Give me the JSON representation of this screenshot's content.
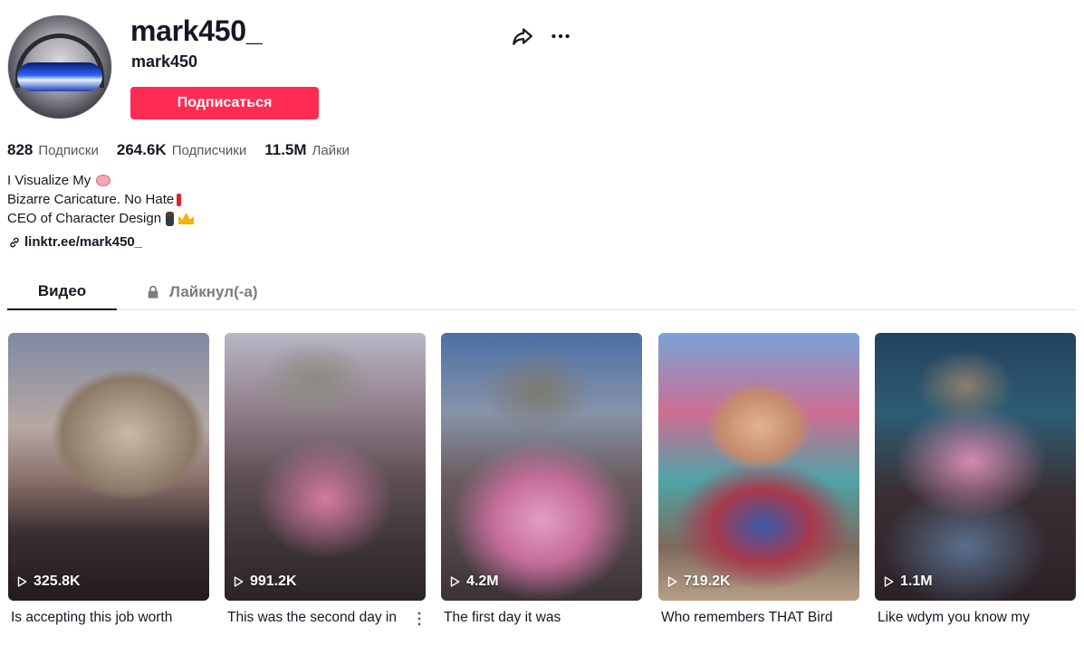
{
  "profile": {
    "username": "mark450_",
    "nickname": "mark450",
    "follow_label": "Подписаться"
  },
  "stats": [
    {
      "value": "828",
      "label": "Подписки"
    },
    {
      "value": "264.6K",
      "label": "Подписчики"
    },
    {
      "value": "11.5M",
      "label": "Лайки"
    }
  ],
  "bio": {
    "line1": "I Visualize My",
    "line2": "Bizarre Caricature. No Hate",
    "line3": "CEO of Character Design",
    "link": "linktr.ee/mark450_"
  },
  "tabs": {
    "videos": "Видео",
    "liked": "Лайкнул(-а)"
  },
  "icons": {
    "share": "share-arrow-icon",
    "more": "more-horizontal-icon",
    "lock": "lock-icon",
    "link": "link-icon",
    "play": "play-icon"
  },
  "videos": [
    {
      "views": "325.8K",
      "caption": "Is accepting this job worth"
    },
    {
      "views": "991.2K",
      "caption": "This was the second day in"
    },
    {
      "views": "4.2M",
      "caption": "The first day it was"
    },
    {
      "views": "719.2K",
      "caption": "Who remembers THAT Bird"
    },
    {
      "views": "1.1M",
      "caption": "Like wdym you know my"
    }
  ],
  "colors": {
    "accent": "#fe2c55",
    "text": "#161823",
    "muted": "#57575f"
  }
}
